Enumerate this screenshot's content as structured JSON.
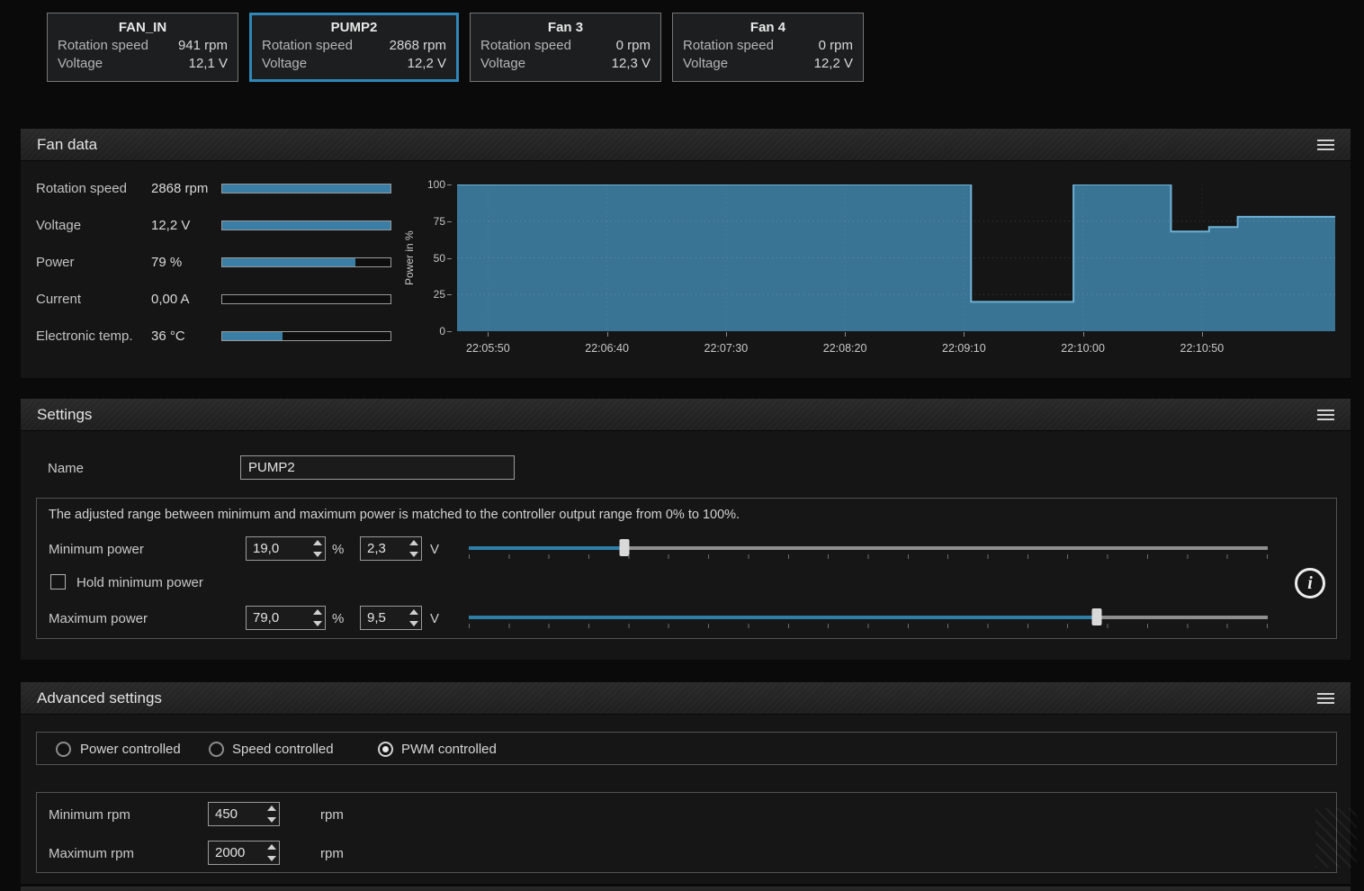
{
  "colors": {
    "accent": "#2e7ea8",
    "chart_fill": "#3a7495",
    "chart_stroke": "#6db0d4",
    "selected_card_border": "#2f87b8"
  },
  "fan_cards": [
    {
      "name": "FAN_IN",
      "selected": false,
      "rows": [
        {
          "label": "Rotation speed",
          "value": "941 rpm"
        },
        {
          "label": "Voltage",
          "value": "12,1 V"
        }
      ]
    },
    {
      "name": "PUMP2",
      "selected": true,
      "rows": [
        {
          "label": "Rotation speed",
          "value": "2868 rpm"
        },
        {
          "label": "Voltage",
          "value": "12,2 V"
        }
      ]
    },
    {
      "name": "Fan 3",
      "selected": false,
      "rows": [
        {
          "label": "Rotation speed",
          "value": "0 rpm"
        },
        {
          "label": "Voltage",
          "value": "12,3 V"
        }
      ]
    },
    {
      "name": "Fan 4",
      "selected": false,
      "rows": [
        {
          "label": "Rotation speed",
          "value": "0 rpm"
        },
        {
          "label": "Voltage",
          "value": "12,2 V"
        }
      ]
    }
  ],
  "fan_data_panel": {
    "title": "Fan data",
    "metrics": [
      {
        "label": "Rotation speed",
        "value": "2868 rpm",
        "bar_pct": 100
      },
      {
        "label": "Voltage",
        "value": "12,2 V",
        "bar_pct": 100
      },
      {
        "label": "Power",
        "value": "79 %",
        "bar_pct": 79
      },
      {
        "label": "Current",
        "value": "0,00 A",
        "bar_pct": 0
      },
      {
        "label": "Electronic temp.",
        "value": "36 °C",
        "bar_pct": 36
      }
    ]
  },
  "chart_data": {
    "type": "area",
    "title": "",
    "ylabel": "Power in %",
    "ylim": [
      0,
      100
    ],
    "y_ticks": [
      0,
      25,
      50,
      75,
      100
    ],
    "x_start": "22:05:37",
    "x_end": "22:11:46",
    "x_ticks": [
      "22:05:50",
      "22:06:40",
      "22:07:30",
      "22:08:20",
      "22:09:10",
      "22:10:00",
      "22:10:50"
    ],
    "series_name": "Power",
    "points": [
      {
        "t": "22:05:37",
        "v": 100
      },
      {
        "t": "22:09:13",
        "v": 100
      },
      {
        "t": "22:09:13",
        "v": 20
      },
      {
        "t": "22:09:56",
        "v": 20
      },
      {
        "t": "22:09:56",
        "v": 100
      },
      {
        "t": "22:10:37",
        "v": 100
      },
      {
        "t": "22:10:37",
        "v": 68
      },
      {
        "t": "22:10:53",
        "v": 68
      },
      {
        "t": "22:10:53",
        "v": 71
      },
      {
        "t": "22:11:05",
        "v": 71
      },
      {
        "t": "22:11:05",
        "v": 78
      },
      {
        "t": "22:11:46",
        "v": 78
      }
    ]
  },
  "settings_panel": {
    "title": "Settings",
    "name_label": "Name",
    "name_value": "PUMP2",
    "range_note": "The adjusted range between minimum and maximum power is matched to the controller output range from 0% to 100%.",
    "min_power": {
      "label": "Minimum power",
      "pct": "19,0",
      "pct_unit": "%",
      "volt": "2,3",
      "volt_unit": "V",
      "slider_pct": 19.5
    },
    "hold_label": "Hold minimum power",
    "hold_checked": false,
    "max_power": {
      "label": "Maximum power",
      "pct": "79,0",
      "pct_unit": "%",
      "volt": "9,5",
      "volt_unit": "V",
      "slider_pct": 78.6
    },
    "info_glyph": "i"
  },
  "advanced_panel": {
    "title": "Advanced settings",
    "modes": [
      {
        "label": "Power controlled",
        "selected": false
      },
      {
        "label": "Speed controlled",
        "selected": false
      },
      {
        "label": "PWM controlled",
        "selected": true
      }
    ],
    "min_rpm": {
      "label": "Minimum rpm",
      "value": "450",
      "unit": "rpm"
    },
    "max_rpm": {
      "label": "Maximum rpm",
      "value": "2000",
      "unit": "rpm"
    }
  }
}
